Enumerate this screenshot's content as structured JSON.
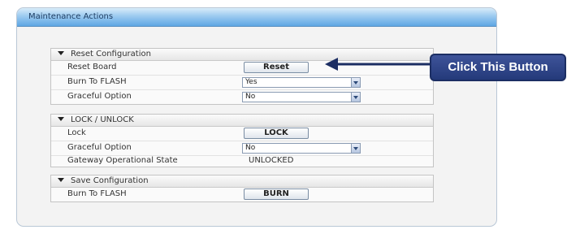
{
  "panel": {
    "title": "Maintenance Actions"
  },
  "sections": {
    "reset": {
      "title": "Reset Configuration",
      "rows": {
        "reset_board": {
          "label": "Reset Board",
          "button": "Reset"
        },
        "burn_to_flash": {
          "label": "Burn To FLASH",
          "value": "Yes"
        },
        "graceful_option": {
          "label": "Graceful Option",
          "value": "No"
        }
      }
    },
    "lock": {
      "title": "LOCK / UNLOCK",
      "rows": {
        "lock": {
          "label": "Lock",
          "button": "LOCK"
        },
        "graceful_option": {
          "label": "Graceful Option",
          "value": "No"
        },
        "gateway_state": {
          "label": "Gateway Operational State",
          "value": "UNLOCKED"
        }
      }
    },
    "save": {
      "title": "Save Configuration",
      "rows": {
        "burn_to_flash": {
          "label": "Burn To FLASH",
          "button": "BURN"
        }
      }
    }
  },
  "annotation": {
    "text": "Click This Button",
    "color": "#243a7a"
  },
  "icons": [
    "collapse-triangle-icon",
    "dropdown-arrow-icon",
    "pointer-arrow-icon"
  ]
}
